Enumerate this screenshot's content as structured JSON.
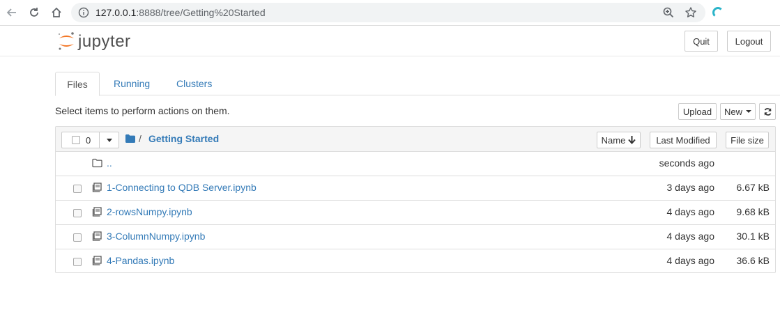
{
  "browser": {
    "url_host": "127.0.0.1",
    "url_rest": ":8888/tree/Getting%20Started",
    "icons": [
      "back-icon",
      "reload-icon",
      "home-icon",
      "info-icon",
      "zoom-icon",
      "star-icon",
      "extension-icon"
    ]
  },
  "header": {
    "logo_text": "jupyter",
    "quit_label": "Quit",
    "logout_label": "Logout"
  },
  "tabs": [
    {
      "label": "Files",
      "active": true
    },
    {
      "label": "Running",
      "active": false
    },
    {
      "label": "Clusters",
      "active": false
    }
  ],
  "toolbar": {
    "select_message": "Select items to perform actions on them.",
    "upload_label": "Upload",
    "new_label": "New"
  },
  "list_header": {
    "selected_count": "0",
    "path_separator": "/",
    "current_folder": "Getting Started",
    "sort_name_label": "Name",
    "sort_modified_label": "Last Modified",
    "sort_size_label": "File size"
  },
  "rows": [
    {
      "name": "..",
      "modified": "seconds ago",
      "size": "",
      "type": "parent"
    },
    {
      "name": "1-Connecting to QDB Server.ipynb",
      "modified": "3 days ago",
      "size": "6.67 kB",
      "type": "notebook"
    },
    {
      "name": "2-rowsNumpy.ipynb",
      "modified": "4 days ago",
      "size": "9.68 kB",
      "type": "notebook"
    },
    {
      "name": "3-ColumnNumpy.ipynb",
      "modified": "4 days ago",
      "size": "30.1 kB",
      "type": "notebook"
    },
    {
      "name": "4-Pandas.ipynb",
      "modified": "4 days ago",
      "size": "36.6 kB",
      "type": "notebook"
    }
  ],
  "colors": {
    "link": "#337ab7",
    "logo_orange": "#f37726",
    "border": "#dddddd"
  }
}
